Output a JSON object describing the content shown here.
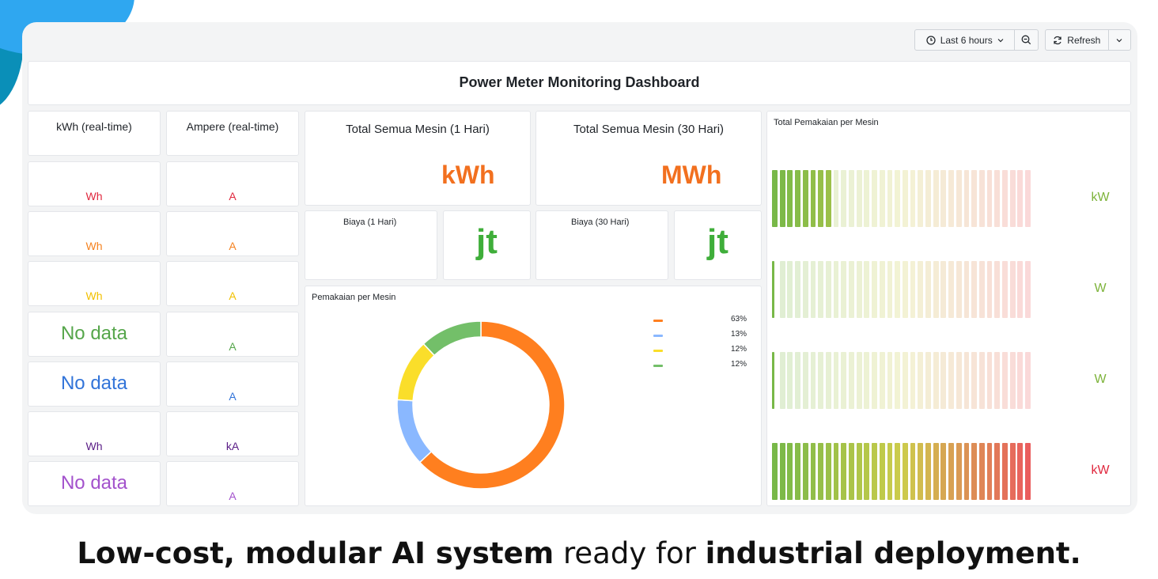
{
  "toolbar": {
    "time_range_label": "Last 6 hours",
    "refresh_label": "Refresh"
  },
  "dashboard": {
    "title": "Power Meter Monitoring Dashboard"
  },
  "kwh_column": {
    "header": "kWh (real-time)",
    "rows": [
      {
        "unit": "Wh",
        "color": "#e0283e"
      },
      {
        "unit": "Wh",
        "color": "#f58220"
      },
      {
        "unit": "Wh",
        "color": "#f2c000"
      },
      {
        "value": "No data",
        "color": "#56a64b"
      },
      {
        "value": "No data",
        "color": "#3274d9"
      },
      {
        "unit": "Wh",
        "color": "#5a1d86"
      },
      {
        "value": "No data",
        "color": "#a352cc"
      }
    ]
  },
  "ampere_column": {
    "header": "Ampere (real-time)",
    "rows": [
      {
        "unit": "A",
        "color": "#e0283e"
      },
      {
        "unit": "A",
        "color": "#f58220"
      },
      {
        "unit": "A",
        "color": "#f2c000"
      },
      {
        "unit": "A",
        "color": "#56a64b"
      },
      {
        "unit": "A",
        "color": "#3274d9"
      },
      {
        "unit": "kA",
        "color": "#5a1d86"
      },
      {
        "unit": "A",
        "color": "#a352cc"
      }
    ]
  },
  "totals": {
    "day": {
      "title": "Total Semua Mesin (1 Hari)",
      "unit": "kWh",
      "color": "#f2701f"
    },
    "month": {
      "title": "Total Semua Mesin (30 Hari)",
      "unit": "MWh",
      "color": "#f2701f"
    }
  },
  "costs": {
    "day": {
      "title": "Biaya (1 Hari)",
      "unit": "jt"
    },
    "month": {
      "title": "Biaya (30 Hari)",
      "unit": "jt"
    }
  },
  "pie_panel": {
    "title": "Pemakaian per Mesin"
  },
  "chart_data": {
    "type": "pie",
    "style": "donut",
    "title": "Pemakaian per Mesin",
    "slices": [
      {
        "value": 63,
        "label": "63%",
        "color": "#ff7f1f"
      },
      {
        "value": 13,
        "label": "13%",
        "color": "#8ab8ff"
      },
      {
        "value": 12,
        "label": "12%",
        "color": "#fade2a"
      },
      {
        "value": 12,
        "label": "12%",
        "color": "#73bf69"
      }
    ]
  },
  "bar_gauge_panel": {
    "title": "Total Pemakaian per Mesin",
    "gauges": [
      {
        "unit": "kW",
        "fill": 0.24,
        "unit_color": "#7db33a"
      },
      {
        "unit": "W",
        "fill": 0.03,
        "unit_color": "#7db33a"
      },
      {
        "unit": "W",
        "fill": 0.03,
        "unit_color": "#7db33a"
      },
      {
        "unit": "kW",
        "fill": 1.0,
        "unit_color": "#e0283e"
      }
    ]
  },
  "caption": {
    "bold_1": "Low-cost, modular AI system",
    "regular": " ready for ",
    "bold_2": "industrial deployment."
  }
}
